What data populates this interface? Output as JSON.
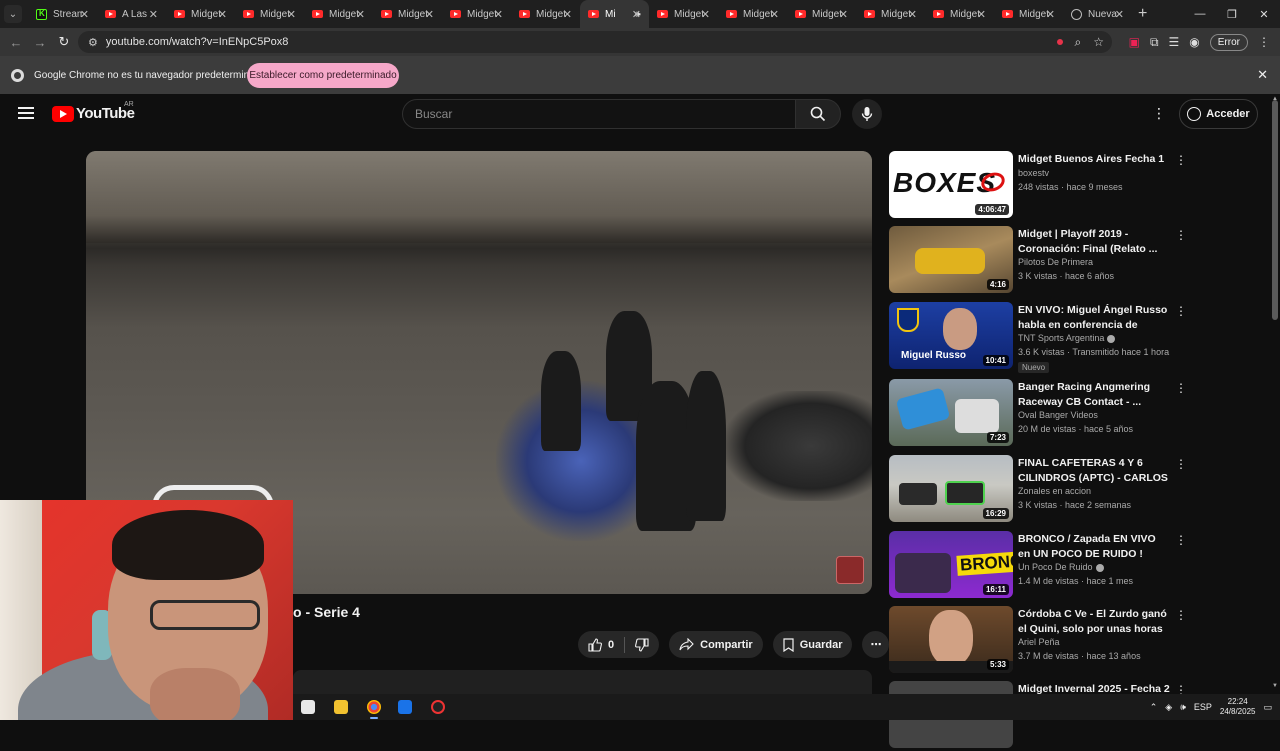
{
  "browser": {
    "tabs": [
      {
        "title": "Stream",
        "icon": "kick-icon"
      },
      {
        "title": "A Las",
        "icon": "youtube-icon"
      },
      {
        "title": "Midget",
        "icon": "youtube-icon"
      },
      {
        "title": "Midget",
        "icon": "youtube-icon"
      },
      {
        "title": "Midget",
        "icon": "youtube-icon"
      },
      {
        "title": "Midget",
        "icon": "youtube-icon"
      },
      {
        "title": "Midget",
        "icon": "youtube-icon"
      },
      {
        "title": "Midget",
        "icon": "youtube-icon"
      },
      {
        "title": "Mi",
        "icon": "youtube-icon",
        "active": true,
        "audio": true
      },
      {
        "title": "Midget",
        "icon": "youtube-icon"
      },
      {
        "title": "Midget",
        "icon": "youtube-icon"
      },
      {
        "title": "Midget",
        "icon": "youtube-icon"
      },
      {
        "title": "Midget",
        "icon": "youtube-icon"
      },
      {
        "title": "Midget",
        "icon": "youtube-icon"
      },
      {
        "title": "Midget",
        "icon": "youtube-icon"
      },
      {
        "title": "Nueva",
        "icon": "globe-icon"
      }
    ],
    "new_tab_label": "+",
    "url": "youtube.com/watch?v=InENpC5Pox8",
    "profile_button": "Error",
    "infobar_message": "Google Chrome no es tu navegador predeterminado",
    "infobar_button": "Establecer como predeterminado"
  },
  "youtube": {
    "logo_text": "YouTube",
    "country_code": "AR",
    "search_placeholder": "Buscar",
    "signin_label": "Acceder",
    "video": {
      "title_visible": "o - Serie 4",
      "likes": "0",
      "share_label": "Compartir",
      "save_label": "Guardar"
    },
    "recommendations": [
      {
        "title": "Midget Buenos Aires Fecha 1",
        "channel": "boxestv",
        "verified": false,
        "meta": "248 vistas · hace 9 meses",
        "duration": "4:06:47",
        "thumb": "boxes",
        "thumb_text": "BOXES"
      },
      {
        "title": "Midget | Playoff 2019 - Coronación: Final (Relato ...",
        "channel": "Pilotos De Primera",
        "verified": false,
        "meta": "3 K vistas · hace 6 años",
        "duration": "4:16",
        "thumb": "sprint"
      },
      {
        "title": "EN VIVO: Miguel Ángel Russo habla en conferencia de prens...",
        "channel": "TNT Sports Argentina",
        "verified": true,
        "meta": "3.6 K vistas · Transmitido hace 1 hora",
        "duration": "10:41",
        "thumb": "russo",
        "thumb_text": "Miguel Russo",
        "badge": "Nuevo"
      },
      {
        "title": "Banger Racing Angmering Raceway CB Contact - ...",
        "channel": "Oval Banger Videos",
        "verified": false,
        "meta": "20 M de vistas · hace 5 años",
        "duration": "7:23",
        "thumb": "banger"
      },
      {
        "title": "FINAL CAFETERAS 4 Y 6 CILINDROS  (APTC) - CARLOS ...",
        "channel": "Zonales en accion",
        "verified": false,
        "meta": "3 K vistas · hace 2 semanas",
        "duration": "16:29",
        "thumb": "cafet"
      },
      {
        "title": "BRONCO / Zapada EN VIVO en UN POCO DE RUIDO !",
        "channel": "Un Poco De Ruido",
        "verified": true,
        "meta": "1.4 M de vistas · hace 1 mes",
        "duration": "16:11",
        "thumb": "bronco",
        "thumb_text": "BRONCO"
      },
      {
        "title": "Córdoba C Ve - El Zurdo ganó el Quini, solo por unas horas",
        "channel": "Ariel Peña",
        "verified": false,
        "meta": "3.7 M de vistas · hace 13 años",
        "duration": "5:33",
        "thumb": "zurdo"
      },
      {
        "title": "Midget Invernal 2025 - Fecha 2 - ...",
        "channel": "",
        "verified": false,
        "meta": "",
        "duration": "",
        "thumb": "last"
      }
    ]
  },
  "taskbar": {
    "language": "ESP",
    "time": "22:24",
    "date": "24/8/2025"
  },
  "colors": {
    "yt_red": "#ff0000",
    "infobar_button_bg": "#f6a8c9",
    "page_bg": "#0f0f0f"
  }
}
